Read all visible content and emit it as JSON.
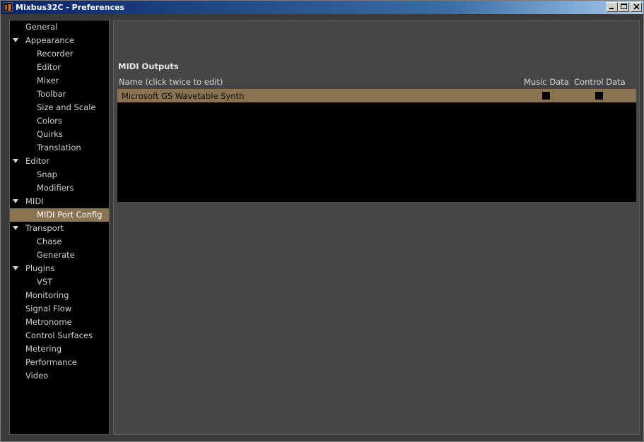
{
  "window": {
    "title": "Mixbus32C - Preferences"
  },
  "sidebar": {
    "items": [
      {
        "label": "General",
        "level": 0,
        "expander": false
      },
      {
        "label": "Appearance",
        "level": 0,
        "expander": true
      },
      {
        "label": "Recorder",
        "level": 1,
        "expander": false
      },
      {
        "label": "Editor",
        "level": 1,
        "expander": false
      },
      {
        "label": "Mixer",
        "level": 1,
        "expander": false
      },
      {
        "label": "Toolbar",
        "level": 1,
        "expander": false
      },
      {
        "label": "Size and Scale",
        "level": 1,
        "expander": false
      },
      {
        "label": "Colors",
        "level": 1,
        "expander": false
      },
      {
        "label": "Quirks",
        "level": 1,
        "expander": false
      },
      {
        "label": "Translation",
        "level": 1,
        "expander": false
      },
      {
        "label": "Editor",
        "level": 0,
        "expander": true
      },
      {
        "label": "Snap",
        "level": 1,
        "expander": false
      },
      {
        "label": "Modifiers",
        "level": 1,
        "expander": false
      },
      {
        "label": "MIDI",
        "level": 0,
        "expander": true
      },
      {
        "label": "MIDI Port Config",
        "level": 1,
        "expander": false,
        "selected": true
      },
      {
        "label": "Transport",
        "level": 0,
        "expander": true
      },
      {
        "label": "Chase",
        "level": 1,
        "expander": false
      },
      {
        "label": "Generate",
        "level": 1,
        "expander": false
      },
      {
        "label": "Plugins",
        "level": 0,
        "expander": true
      },
      {
        "label": "VST",
        "level": 1,
        "expander": false
      },
      {
        "label": "Monitoring",
        "level": 0,
        "expander": false
      },
      {
        "label": "Signal Flow",
        "level": 0,
        "expander": false
      },
      {
        "label": "Metronome",
        "level": 0,
        "expander": false
      },
      {
        "label": "Control Surfaces",
        "level": 0,
        "expander": false
      },
      {
        "label": "Metering",
        "level": 0,
        "expander": false
      },
      {
        "label": "Performance",
        "level": 0,
        "expander": false
      },
      {
        "label": "Video",
        "level": 0,
        "expander": false
      }
    ]
  },
  "midi_outputs": {
    "title": "MIDI Outputs",
    "columns": {
      "name": "Name (click twice to edit)",
      "music": "Music Data",
      "control": "Control Data"
    },
    "rows": [
      {
        "name": "Microsoft GS Wavetable Synth",
        "music_data": true,
        "control_data": true
      }
    ]
  },
  "colors": {
    "selection": "#8a7350",
    "panel": "#464646",
    "list_bg": "#000000"
  }
}
